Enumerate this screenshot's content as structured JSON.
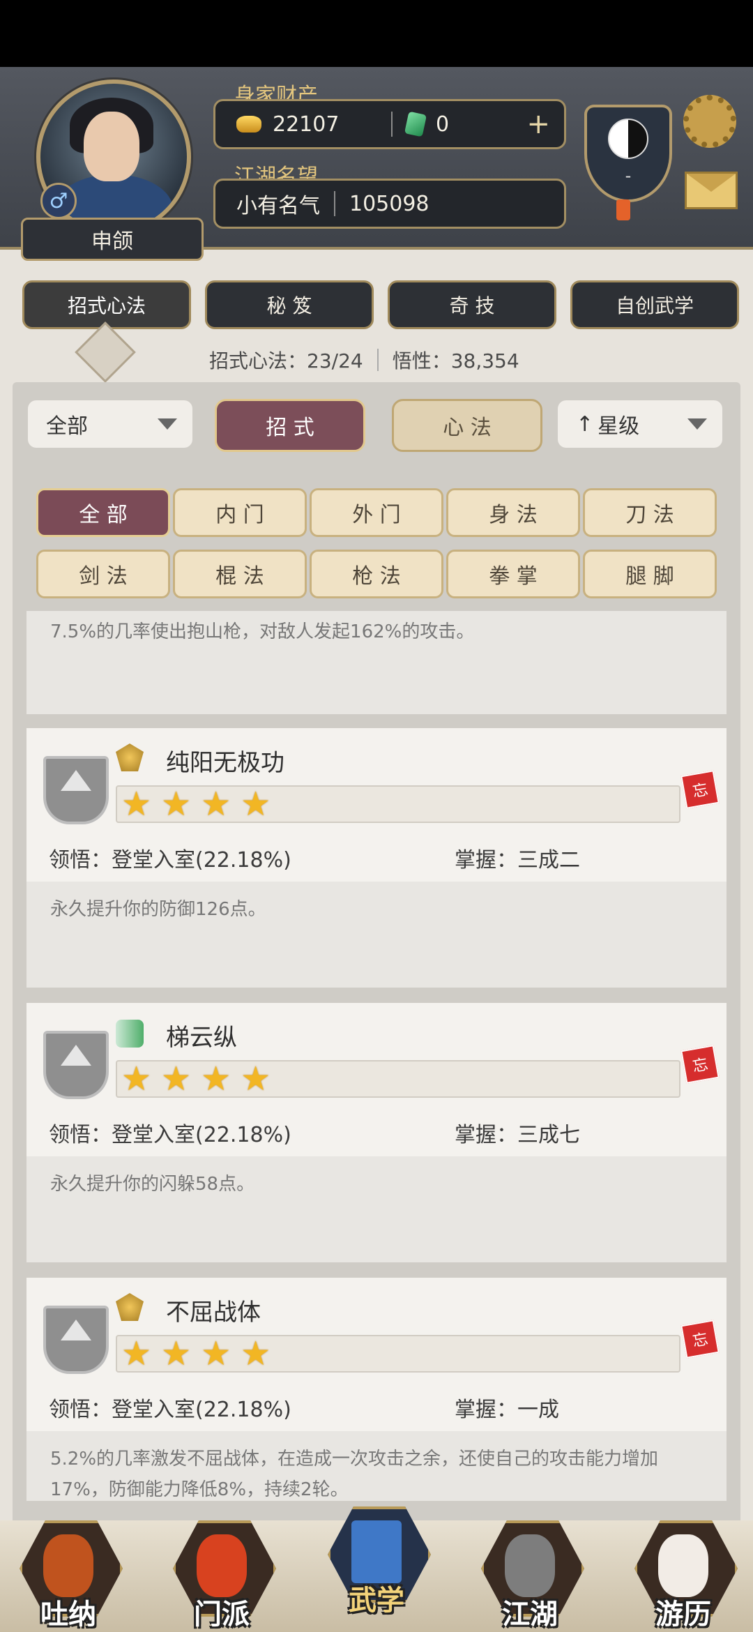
{
  "profile": {
    "name": "申颌",
    "gender_symbol": "♂",
    "wealth_label": "身家财产",
    "gold": "22107",
    "jade": "0",
    "reputation_label": "江湖名望",
    "reputation_title": "小有名气",
    "reputation_value": "105098",
    "sect_name": "-"
  },
  "top_tabs": [
    {
      "label": "招式心法",
      "active": true
    },
    {
      "label": "秘 笈",
      "active": false
    },
    {
      "label": "奇 技",
      "active": false
    },
    {
      "label": "自创武学",
      "active": false
    }
  ],
  "stats": {
    "moves": "招式心法：23/24",
    "insight": "悟性：38,354"
  },
  "filters": {
    "category_dropdown": "全部",
    "toggle_moves": "招 式",
    "toggle_mind": "心 法",
    "sort_arrow": "↑",
    "sort_dropdown": "星级"
  },
  "chips": [
    {
      "label": "全 部",
      "active": true
    },
    {
      "label": "内 门",
      "active": false
    },
    {
      "label": "外 门",
      "active": false
    },
    {
      "label": "身 法",
      "active": false
    },
    {
      "label": "刀 法",
      "active": false
    },
    {
      "label": "剑 法",
      "active": false
    },
    {
      "label": "棍 法",
      "active": false
    },
    {
      "label": "枪 法",
      "active": false
    },
    {
      "label": "拳 掌",
      "active": false
    },
    {
      "label": "腿 脚",
      "active": false
    }
  ],
  "partial_card_desc": "7.5%的几率使出抱山枪，对敌人发起162%的攻击。",
  "skills": [
    {
      "name": "纯阳无极功",
      "type_icon": "internal-art-icon",
      "stars": 4,
      "comprehension": "领悟：登堂入室(22.18%)",
      "mastery": "掌握：三成二",
      "description": "永久提升你的防御126点。",
      "forget_label": "忘"
    },
    {
      "name": "梯云纵",
      "type_icon": "movement-art-icon",
      "stars": 4,
      "comprehension": "领悟：登堂入室(22.18%)",
      "mastery": "掌握：三成七",
      "description": "永久提升你的闪躲58点。",
      "forget_label": "忘"
    },
    {
      "name": "不屈战体",
      "type_icon": "internal-art-icon",
      "stars": 4,
      "comprehension": "领悟：登堂入室(22.18%)",
      "mastery": "掌握：一成",
      "description": "5.2%的几率激发不屈战体，在造成一次攻击之余，还使自己的攻击能力增加17%，防御能力降低8%，持续2轮。",
      "forget_label": "忘"
    }
  ],
  "bottom_nav": [
    {
      "label": "吐纳",
      "active": false
    },
    {
      "label": "门派",
      "active": false
    },
    {
      "label": "武学",
      "active": true
    },
    {
      "label": "江湖",
      "active": false
    },
    {
      "label": "游历",
      "active": false
    }
  ]
}
